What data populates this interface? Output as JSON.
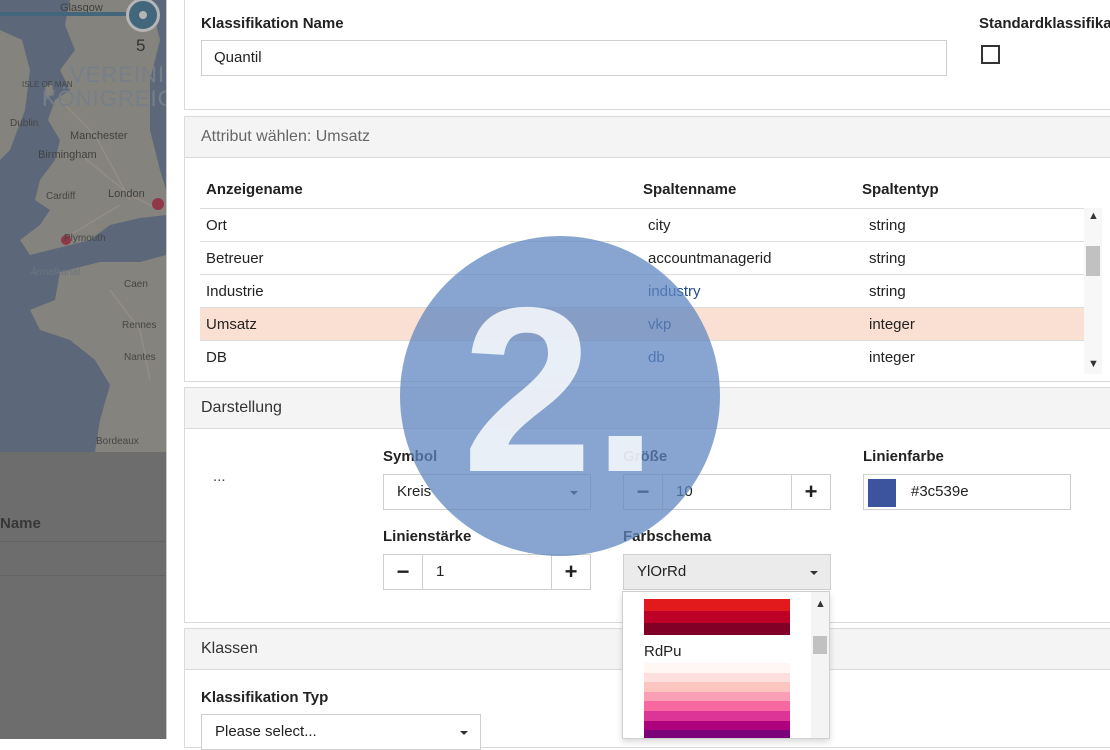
{
  "map": {
    "zoom_level": "5",
    "labels": {
      "glasgow": "Glasgow",
      "vereinigt": "VEREINIGT",
      "konigreich": "KÖNIGREIC",
      "isle_of_man": "ISLE OF MAN",
      "dublin": "Dublin",
      "manchester": "Manchester",
      "birmingham": "Birmingham",
      "cardiff": "Cardiff",
      "london": "London",
      "plymouth": "Plymouth",
      "armelkanal": "Ärmelkanal",
      "caen": "Caen",
      "rennes": "Rennes",
      "nantes": "Nantes",
      "bordeaux": "Bordeaux"
    }
  },
  "left_list": {
    "name_header": "Name"
  },
  "classification": {
    "name_label": "Klassifikation Name",
    "name_value": "Quantil",
    "default_label": "Standardklassifika"
  },
  "attribute": {
    "heading": "Attribut wählen: Umsatz",
    "columns": [
      "Anzeigename",
      "Spaltenname",
      "Spaltentyp"
    ],
    "rows": [
      [
        "Ort",
        "city",
        "string"
      ],
      [
        "Betreuer",
        "accountmanagerid",
        "string"
      ],
      [
        "Industrie",
        "industry",
        "string"
      ],
      [
        "Umsatz",
        "vkp",
        "integer"
      ],
      [
        "DB",
        "db",
        "integer"
      ]
    ],
    "selected_row": 3
  },
  "darstellung": {
    "heading": "Darstellung",
    "preview": "...",
    "symbol_label": "Symbol",
    "symbol_value": "Kreis",
    "size_label": "Größe",
    "size_value": "10",
    "line_color_label": "Linienfarbe",
    "line_color_value": "#3c539e",
    "line_color": "#3c539e",
    "line_width_label": "Linienstärke",
    "line_width_value": "1",
    "scheme_label": "Farbschema",
    "scheme_value": "YlOrRd",
    "minus": "−",
    "plus": "+"
  },
  "scheme_dropdown": {
    "items": [
      {
        "label": "",
        "colors": [
          "#e31a1c",
          "#bd0026",
          "#800026"
        ]
      },
      {
        "label": "RdPu",
        "colors": [
          "#fff7f3",
          "#fde0dd",
          "#fcc5c0",
          "#fa9fb5",
          "#f768a1",
          "#dd3497",
          "#ae017e",
          "#7a0177"
        ]
      }
    ]
  },
  "klassen": {
    "heading": "Klassen",
    "type_label": "Klassifikation Typ",
    "type_placeholder": "Please select..."
  },
  "overlay": {
    "step": "2."
  },
  "colors": {
    "selected_row": "#fae0d3",
    "overlay": "#5d85c0"
  }
}
